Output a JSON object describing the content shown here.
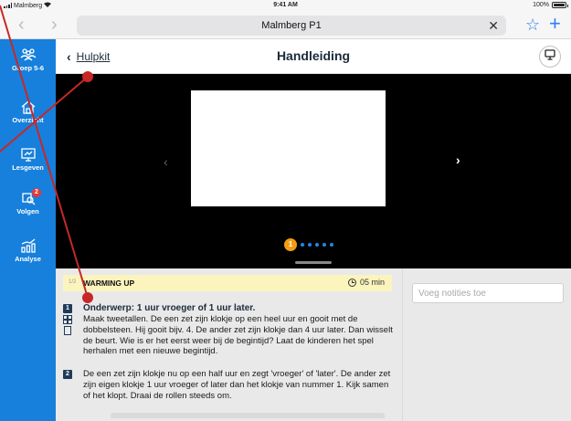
{
  "status_bar": {
    "carrier": "Malmberg",
    "time": "9:41 AM",
    "battery": "100%",
    "battery_level": 1.0
  },
  "browser": {
    "url_text": "Malmberg P1",
    "clear_symbol": "✕"
  },
  "sidebar": {
    "items": [
      {
        "label": "Groep 5-6",
        "icon": "group-icon"
      },
      {
        "label": "Overzicht",
        "icon": "home-icon"
      },
      {
        "label": "Lesgeven",
        "icon": "teach-screen-icon"
      },
      {
        "label": "Volgen",
        "icon": "follow-search-icon",
        "badge": "2"
      },
      {
        "label": "Analyse",
        "icon": "analysis-chart-icon"
      }
    ]
  },
  "header": {
    "back_label": "Hulpkit",
    "title": "Handleiding"
  },
  "carousel": {
    "active_dot": "1",
    "total_dots": 6
  },
  "section": {
    "number": "1/2",
    "title": "WARMING UP",
    "duration": "05 min"
  },
  "lesson": {
    "subject": "Onderwerp: 1 uur vroeger of 1 uur later.",
    "steps": [
      {
        "number": "1",
        "text": "Maak tweetallen. De een zet zijn klokje op een heel uur en gooit met de dobbelsteen. Hij gooit bijv. 4. De ander zet zijn klokje dan 4 uur later. Dan wisselt de beurt. Wie is er het eerst weer bij de begintijd? Laat de kinderen het spel herhalen met een nieuwe begintijd."
      },
      {
        "number": "2",
        "text": "De een zet zijn klokje nu op een half uur en zegt 'vroeger' of 'later'. De ander zet zijn eigen klokje 1 uur vroeger of later dan het klokje van nummer 1. Kijk samen of het klopt. Draai de rollen steeds om."
      }
    ]
  },
  "notes": {
    "placeholder": "Voeg notities toe"
  },
  "colors": {
    "sidebar": "#1680dc",
    "accent_orange": "#f39c12",
    "annotation_red": "#c62828",
    "section_bar": "#fbf4bd"
  }
}
